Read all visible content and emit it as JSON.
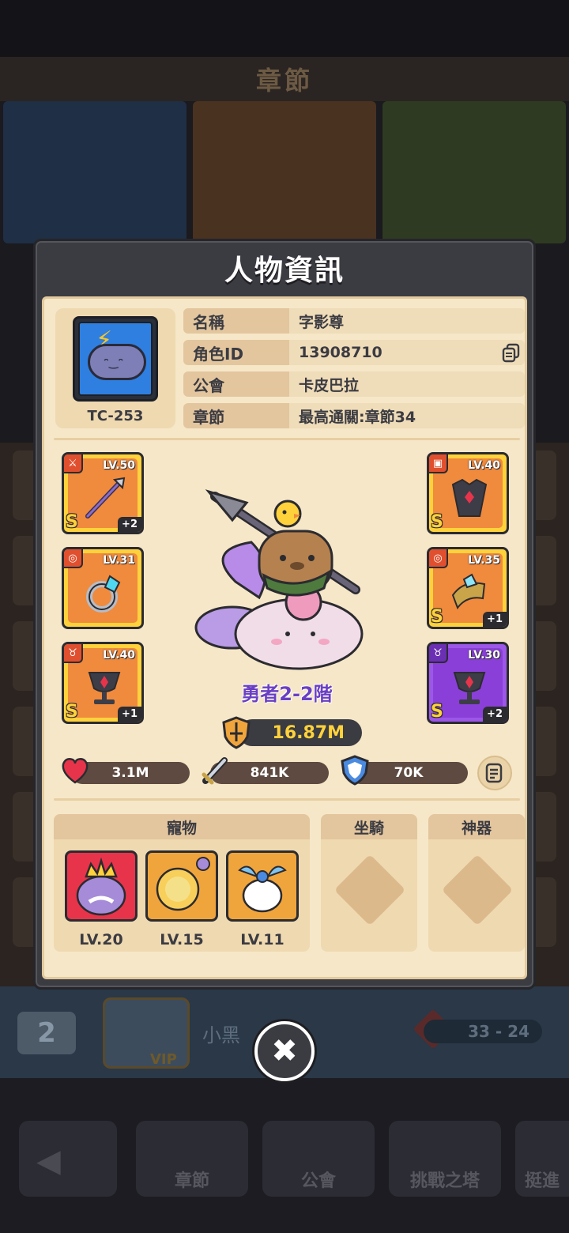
{
  "background": {
    "header_title": "章節",
    "rank": "2",
    "player_name": "小黑",
    "vip_label": "VIP",
    "score": "33 - 24",
    "nav": [
      "章節",
      "公會",
      "挑戰之塔",
      "挺進"
    ]
  },
  "modal": {
    "title": "人物資訊",
    "avatar_code": "TC-253",
    "info": [
      {
        "label": "名稱",
        "value": "字影尊"
      },
      {
        "label": "角色ID",
        "value": "13908710"
      },
      {
        "label": "公會",
        "value": "卡皮巴拉"
      },
      {
        "label": "章節",
        "value": "最高通關:章節34"
      }
    ],
    "equipment_left": [
      {
        "level": "LV.50",
        "grade": "S",
        "plus": "+2",
        "slot_icon": "sword-icon",
        "item": "spear"
      },
      {
        "level": "LV.31",
        "grade": "",
        "plus": "",
        "slot_icon": "ring-icon",
        "item": "ring"
      },
      {
        "level": "LV.40",
        "grade": "S",
        "plus": "+1",
        "slot_icon": "necklace-icon",
        "item": "chalice"
      }
    ],
    "equipment_right": [
      {
        "level": "LV.40",
        "grade": "S",
        "plus": "",
        "slot_icon": "armor-icon",
        "item": "armor"
      },
      {
        "level": "LV.35",
        "grade": "S",
        "plus": "+1",
        "slot_icon": "ring-icon",
        "item": "bracer"
      },
      {
        "level": "LV.30",
        "grade": "S",
        "plus": "+2",
        "slot_icon": "necklace-icon",
        "item": "chalice"
      }
    ],
    "hero_rank": "勇者2-2階",
    "power": "16.87M",
    "stats": {
      "hp": "3.1M",
      "attack": "841K",
      "defense": "70K"
    },
    "pets_title": "寵物",
    "pets": [
      {
        "level": "LV.20",
        "color": "#e8344a"
      },
      {
        "level": "LV.15",
        "color": "#f0a53c"
      },
      {
        "level": "LV.11",
        "color": "#f0a53c"
      }
    ],
    "mount_title": "坐騎",
    "artifact_title": "神器"
  },
  "colors": {
    "accent_gold": "#ffd23b",
    "panel_bg": "#f6e7c8",
    "dark": "#3b3b42",
    "purple": "#9c57e8"
  }
}
